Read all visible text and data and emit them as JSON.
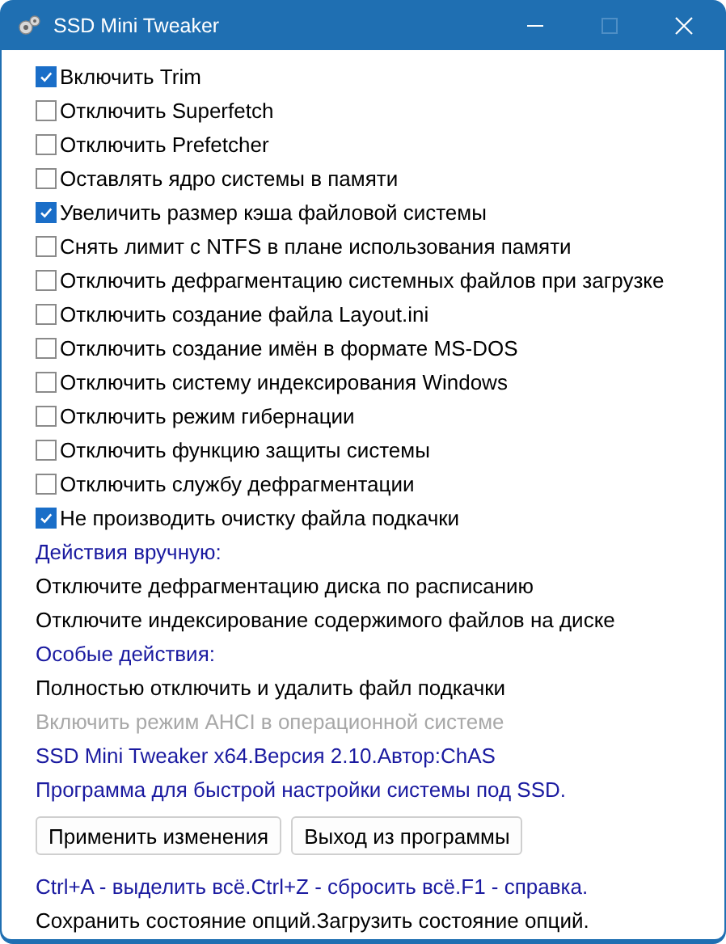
{
  "window": {
    "title": "SSD Mini Tweaker",
    "maximize_disabled": true
  },
  "options": [
    {
      "label": "Включить Trim",
      "checked": true
    },
    {
      "label": "Отключить Superfetch",
      "checked": false
    },
    {
      "label": "Отключить Prefetcher",
      "checked": false
    },
    {
      "label": "Оставлять ядро системы в памяти",
      "checked": false
    },
    {
      "label": "Увеличить размер кэша файловой системы",
      "checked": true
    },
    {
      "label": "Снять лимит с NTFS в плане использования памяти",
      "checked": false
    },
    {
      "label": "Отключить дефрагментацию системных файлов при загрузке",
      "checked": false
    },
    {
      "label": "Отключить создание файла Layout.ini",
      "checked": false
    },
    {
      "label": "Отключить создание имён в формате MS-DOS",
      "checked": false
    },
    {
      "label": "Отключить систему индексирования Windows",
      "checked": false
    },
    {
      "label": "Отключить режим гибернации",
      "checked": false
    },
    {
      "label": "Отключить функцию защиты системы",
      "checked": false
    },
    {
      "label": "Отключить службу дефрагментации",
      "checked": false
    },
    {
      "label": "Не производить очистку файла подкачки",
      "checked": true
    }
  ],
  "lines": [
    {
      "kind": "heading",
      "text": "Действия вручную:"
    },
    {
      "kind": "action",
      "text": "Отключите дефрагментацию диска по расписанию"
    },
    {
      "kind": "action",
      "text": "Отключите индексирование содержимого файлов на диске"
    },
    {
      "kind": "heading",
      "text": "Особые действия:"
    },
    {
      "kind": "action",
      "text": "Полностью отключить и удалить файл подкачки"
    },
    {
      "kind": "disabled",
      "text": "Включить режим AHCI в операционной системе"
    },
    {
      "kind": "info",
      "text": "SSD Mini Tweaker x64.Версия 2.10.Автор:ChAS"
    },
    {
      "kind": "info",
      "text": "Программа для быстрой настройки системы под SSD."
    }
  ],
  "buttons": [
    "Применить изменения",
    "Выход из программы"
  ],
  "footer": [
    {
      "kind": "info",
      "text": "Ctrl+A - выделить всё.Ctrl+Z - сбросить всё.F1 - справка."
    },
    {
      "kind": "action",
      "text": "Сохранить состояние опций.Загрузить состояние опций."
    }
  ]
}
